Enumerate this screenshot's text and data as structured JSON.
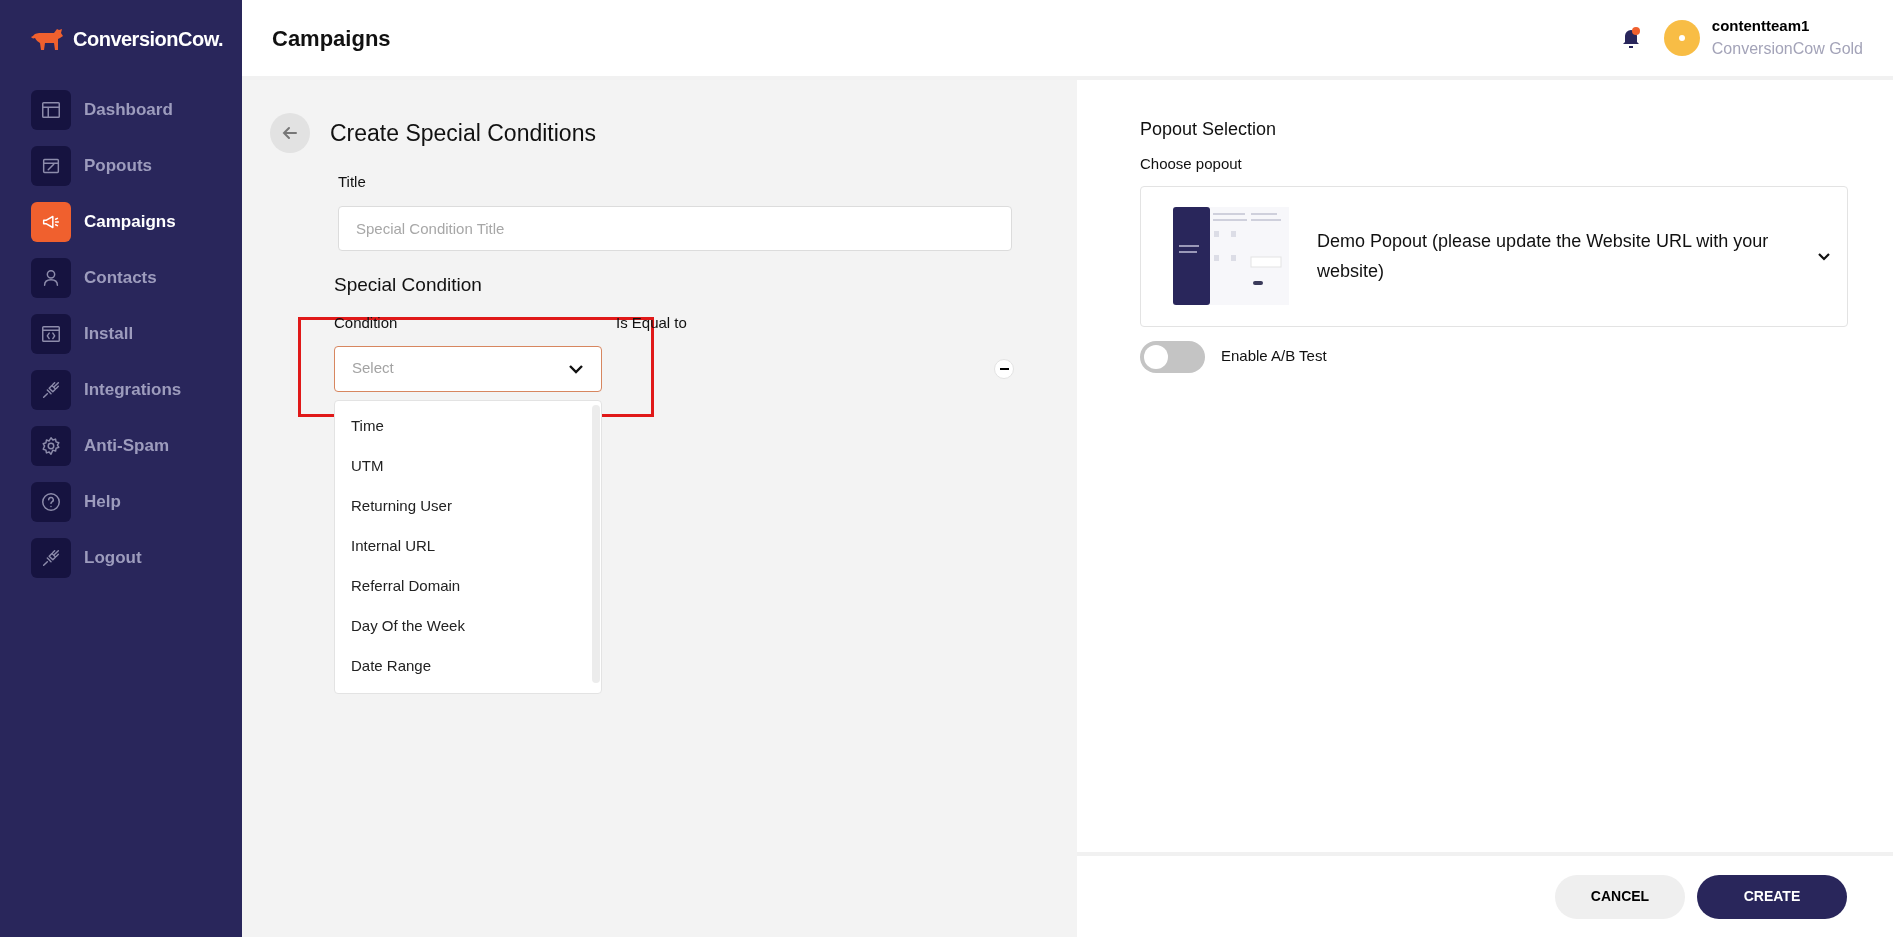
{
  "sidebar": {
    "logo": "ConversionCow.",
    "items": [
      {
        "label": "Dashboard",
        "selected": false
      },
      {
        "label": "Popouts",
        "selected": false
      },
      {
        "label": "Campaigns",
        "selected": true
      },
      {
        "label": "Contacts",
        "selected": false
      },
      {
        "label": "Install",
        "selected": false
      },
      {
        "label": "Integrations",
        "selected": false
      },
      {
        "label": "Anti-Spam",
        "selected": false
      },
      {
        "label": "Help",
        "selected": false
      },
      {
        "label": "Logout",
        "selected": false
      }
    ]
  },
  "header": {
    "title": "Campaigns",
    "user": {
      "name": "contentteam1",
      "plan": "ConversionCow Gold"
    }
  },
  "form": {
    "heading": "Create Special Conditions",
    "title_field": {
      "label": "Title",
      "placeholder": "Special Condition Title"
    },
    "section": "Special Condition",
    "condition_label": "Condition",
    "value_label": "Is Equal to",
    "condition_select": {
      "placeholder": "Select",
      "open": true,
      "options": [
        "Time",
        "UTM",
        "Returning User",
        "Internal URL",
        "Referral Domain",
        "Day Of the Week",
        "Date Range"
      ]
    }
  },
  "popout_selection": {
    "heading": "Popout Selection",
    "label": "Choose popout",
    "selected_popout": "Demo Popout (please update the Website URL with your website)",
    "ab_test": {
      "label": "Enable A/B Test",
      "on": false
    }
  },
  "buttons": [
    {
      "label": "CANCEL",
      "kind": "secondary"
    },
    {
      "label": "CREATE",
      "kind": "primary"
    }
  ]
}
